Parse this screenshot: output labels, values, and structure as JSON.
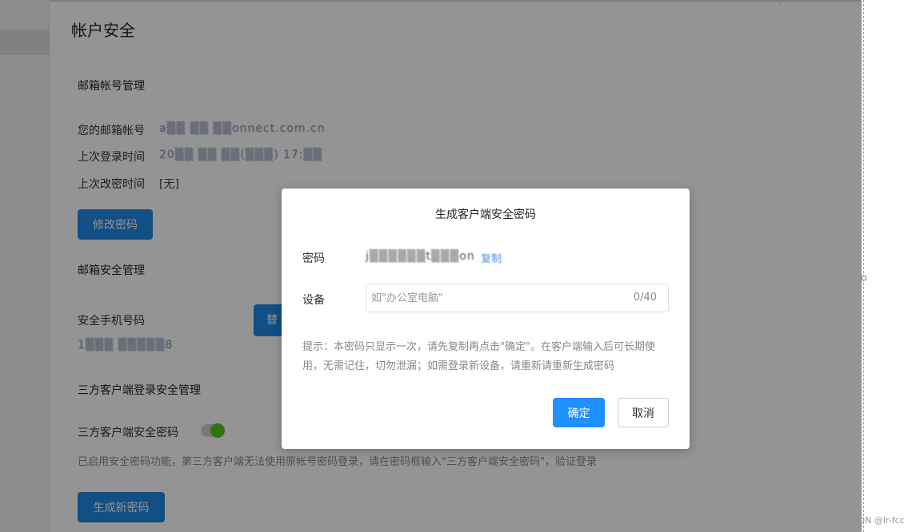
{
  "page": {
    "title": "帐户安全"
  },
  "email_section": {
    "title": "邮箱帐号管理",
    "email_label": "您的邮箱帐号",
    "email_value": "a▒▒ ▒▒ ▒▒onnect.com.cn",
    "last_login_label": "上次登录时间",
    "last_login_value": "20▒▒ ▒▒ ▒▒(▒▒▒) 17:▒▒",
    "last_pwd_change_label": "上次改密时间",
    "last_pwd_change_value": "[无]",
    "change_password_button": "修改密码"
  },
  "mailbox_security_section": {
    "title": "邮箱安全管理",
    "phone_label": "安全手机号码",
    "phone_value": "1▒▒▒ ▒▒▒▒▒8",
    "replace_button_partial": "替"
  },
  "third_party_section": {
    "title": "三方客户端登录安全管理",
    "toggle_label": "三方客户端安全密码",
    "toggle_on": true,
    "hint": "已启用安全密码功能，第三方客户端无法使用原帐号密码登录，请在密码框输入\"三方客户端安全密码\"，验证登录",
    "generate_button": "生成新密码"
  },
  "dialog": {
    "title": "生成客户端安全密码",
    "password_label": "密码",
    "password_value": "j▒▒▒▒▒▒t▒▒▒on",
    "copy_link": "复制",
    "device_label": "设备",
    "device_placeholder": "如\"办公室电脑\"",
    "device_value": "",
    "device_counter": "0/40",
    "tip": "提示：本密码只显示一次，请先复制再点击\"确定\"。在客户端输入后可长期使用，无需记住，切勿泄漏；如需登录新设备，请重新请重新生成密码",
    "confirm_button": "确定",
    "cancel_button": "取消"
  },
  "watermark": "CSDN @lr-fcc",
  "colors": {
    "primary": "#1e88e5",
    "toggle_on": "#52c41a",
    "overlay": "rgba(0,0,0,0.42)"
  }
}
